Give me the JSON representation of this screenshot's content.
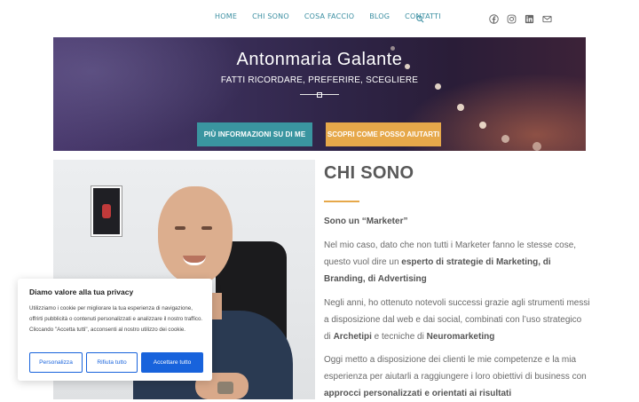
{
  "nav": {
    "items": [
      "HOME",
      "CHI SONO",
      "COSA FACCIO",
      "BLOG",
      "CONTATTI"
    ],
    "search_icon": "search-icon",
    "social_icons": [
      "facebook-icon",
      "instagram-icon",
      "linkedin-icon",
      "mail-icon"
    ],
    "link_color": "#3a8ea1"
  },
  "hero": {
    "title": "Antonmaria Galante",
    "subtitle": "FATTI RICORDARE, PREFERIRE, SCEGLIERE",
    "button_info": "PIÙ INFORMAZIONI SU DI ME",
    "button_how": "SCOPRI COME POSSO AIUTARTI",
    "button_info_color": "#3a95a0",
    "button_how_color": "#e6a84a"
  },
  "about": {
    "heading": "CHI SONO",
    "intro": "Sono un “Marketer”",
    "p1_a": "Nel mio caso, dato che non tutti i Marketer fanno le stesse cose, questo vuol dire un ",
    "p1_b": "esperto di strategie di Marketing, di Branding, di Advertising",
    "p2_a": "Negli anni, ho ottenuto notevoli successi grazie agli strumenti messi a disposizione dal web e dai social, combinati con  l’uso strategico di ",
    "p2_b": "Archetipi",
    "p2_c": " e tecniche di ",
    "p2_d": "Neuromarketing",
    "p3_a": "Oggi metto a disposizione dei clienti le mie competenze e la mia esperienza per aiutarli a raggiungere i loro obiettivi di business con ",
    "p3_b": "approcci personalizzati e orientati ai risultati",
    "accent_color": "#e6a84a"
  },
  "cookie": {
    "title": "Diamo valore alla tua privacy",
    "text": "Utilizziamo i cookie per migliorare la tua esperienza di navigazione, offrirti pubblicità o contenuti personalizzati e analizzare il nostro traffico. Cliccando \"Accetta tutti\", acconsenti al nostro utilizzo dei cookie.",
    "customize": "Personalizza",
    "reject": "Rifiuta tutto",
    "accept": "Accettare tutto",
    "button_color": "#1863dc"
  }
}
